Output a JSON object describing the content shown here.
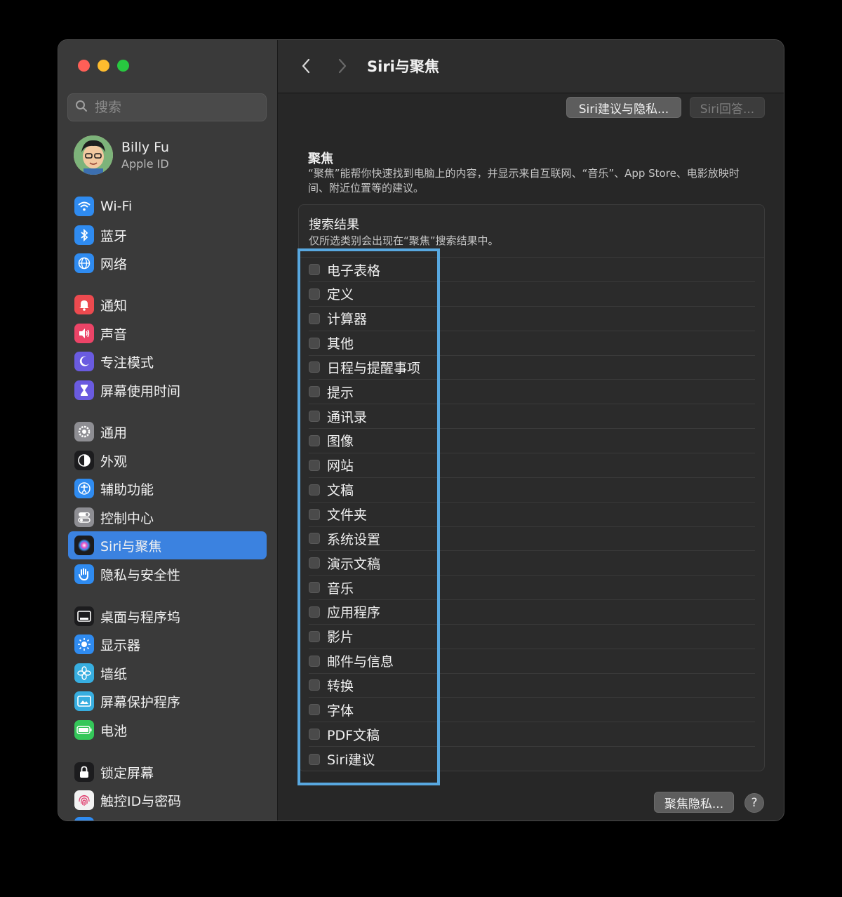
{
  "window": {
    "traffic_lights": [
      "#ff5f57",
      "#febc2e",
      "#28c840"
    ]
  },
  "sidebar": {
    "search_placeholder": "搜索",
    "user": {
      "name": "Billy Fu",
      "subtitle": "Apple ID"
    },
    "items": [
      {
        "label": "Wi-Fi",
        "icon": "wifi-icon",
        "color": "#2f8bf0"
      },
      {
        "label": "蓝牙",
        "icon": "bluetooth-icon",
        "color": "#2f8bf0"
      },
      {
        "label": "网络",
        "icon": "globe-icon",
        "color": "#2f8bf0"
      },
      {
        "label": "通知",
        "icon": "bell-icon",
        "color": "#ec4a4f"
      },
      {
        "label": "声音",
        "icon": "speaker-icon",
        "color": "#ec4467"
      },
      {
        "label": "专注模式",
        "icon": "moon-icon",
        "color": "#6a5be0"
      },
      {
        "label": "屏幕使用时间",
        "icon": "hourglass-icon",
        "color": "#6a5be0"
      },
      {
        "label": "通用",
        "icon": "gear-icon",
        "color": "#8e8e93"
      },
      {
        "label": "外观",
        "icon": "appearance-icon",
        "color": "#1c1c1e"
      },
      {
        "label": "辅助功能",
        "icon": "accessibility-icon",
        "color": "#2f8bf0"
      },
      {
        "label": "控制中心",
        "icon": "control-center-icon",
        "color": "#8e8e93"
      },
      {
        "label": "Siri与聚焦",
        "icon": "siri-icon",
        "color": "#1c1c1e"
      },
      {
        "label": "隐私与安全性",
        "icon": "hand-icon",
        "color": "#2f8bf0"
      },
      {
        "label": "桌面与程序坞",
        "icon": "dock-icon",
        "color": "#1c1c1e"
      },
      {
        "label": "显示器",
        "icon": "sun-icon",
        "color": "#2f8bf0"
      },
      {
        "label": "墙纸",
        "icon": "flower-icon",
        "color": "#37aee0"
      },
      {
        "label": "屏幕保护程序",
        "icon": "screensaver-icon",
        "color": "#37aee0"
      },
      {
        "label": "电池",
        "icon": "battery-icon",
        "color": "#34c759"
      },
      {
        "label": "锁定屏幕",
        "icon": "lock-icon",
        "color": "#1c1c1e"
      },
      {
        "label": "触控ID与密码",
        "icon": "fingerprint-icon",
        "color": "#f2f2f2"
      }
    ],
    "selected": "Siri与聚焦"
  },
  "toolbar": {
    "title": "Siri与聚焦"
  },
  "buttons": {
    "siri_privacy": "Siri建议与隐私...",
    "siri_answers": "Siri回答...",
    "spotlight_privacy": "聚焦隐私...",
    "help": "?"
  },
  "spotlight": {
    "title": "聚焦",
    "description": "“聚焦”能帮你快速找到电脑上的内容，并显示来自互联网、“音乐”、App Store、电影放映时间、附近位置等的建议。"
  },
  "results": {
    "title": "搜索结果",
    "subtitle": "仅所选类别会出现在“聚焦”搜索结果中。",
    "categories": [
      {
        "label": "电子表格",
        "checked": false
      },
      {
        "label": "定义",
        "checked": false
      },
      {
        "label": "计算器",
        "checked": false
      },
      {
        "label": "其他",
        "checked": false
      },
      {
        "label": "日程与提醒事项",
        "checked": false
      },
      {
        "label": "提示",
        "checked": false
      },
      {
        "label": "通讯录",
        "checked": false
      },
      {
        "label": "图像",
        "checked": false
      },
      {
        "label": "网站",
        "checked": false
      },
      {
        "label": "文稿",
        "checked": false
      },
      {
        "label": "文件夹",
        "checked": false
      },
      {
        "label": "系统设置",
        "checked": false
      },
      {
        "label": "演示文稿",
        "checked": false
      },
      {
        "label": "音乐",
        "checked": false
      },
      {
        "label": "应用程序",
        "checked": false
      },
      {
        "label": "影片",
        "checked": false
      },
      {
        "label": "邮件与信息",
        "checked": false
      },
      {
        "label": "转换",
        "checked": false
      },
      {
        "label": "字体",
        "checked": false
      },
      {
        "label": "PDF文稿",
        "checked": false
      },
      {
        "label": "Siri建议",
        "checked": false
      }
    ]
  },
  "highlight_color": "#58a8e0"
}
